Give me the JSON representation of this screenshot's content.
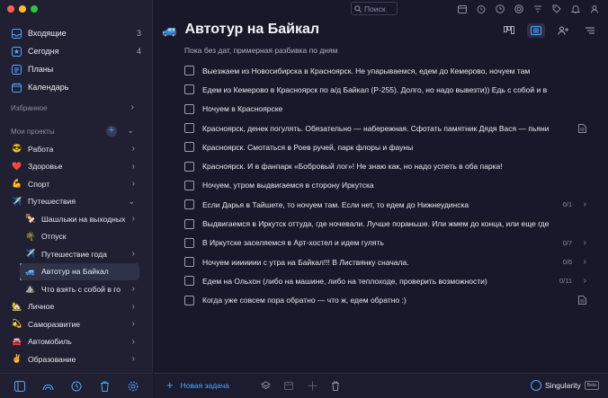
{
  "sidebar": {
    "nav": [
      {
        "label": "Входящие",
        "count": "3",
        "icon": "inbox-icon"
      },
      {
        "label": "Сегодня",
        "count": "4",
        "icon": "star-icon"
      },
      {
        "label": "Планы",
        "count": "",
        "icon": "plans-icon"
      },
      {
        "label": "Календарь",
        "count": "",
        "icon": "calendar-icon"
      }
    ],
    "favorites_label": "Избранное",
    "projects_label": "Мои проекты",
    "projects": [
      {
        "emoji": "😎",
        "label": "Работа",
        "level": 1
      },
      {
        "emoji": "❤️",
        "label": "Здоровье",
        "level": 1
      },
      {
        "emoji": "💪",
        "label": "Спорт",
        "level": 1
      },
      {
        "emoji": "✈️",
        "label": "Путешествия",
        "level": 1
      },
      {
        "emoji": "🍢",
        "label": "Шашлыки на выходных",
        "level": 2
      },
      {
        "emoji": "🌴",
        "label": "Отпуск",
        "level": 2
      },
      {
        "emoji": "✈️",
        "label": "Путешествие года",
        "level": 2
      },
      {
        "emoji": "🚙",
        "label": "Автотур на Байкал",
        "level": 2,
        "active": true
      },
      {
        "emoji": "⛰️",
        "label": "Что взять с собой в го",
        "level": 2
      },
      {
        "emoji": "🏡",
        "label": "Личное",
        "level": 1
      },
      {
        "emoji": "💫",
        "label": "Саморазвитие",
        "level": 1
      },
      {
        "emoji": "🚘",
        "label": "Автомобиль",
        "level": 1
      },
      {
        "emoji": "✌️",
        "label": "Образование",
        "level": 1
      }
    ]
  },
  "topbar": {
    "search_placeholder": "Поиск"
  },
  "project": {
    "emoji": "🚙",
    "title": "Автотур на Байкал",
    "subtitle": "Пока без дат, примерная разбивка по дням"
  },
  "tasks": [
    {
      "text": "Выезжаем из Новосибирска в Красноярск. Не упарываемся, едем до Кемерово, ночуем там",
      "meta": "",
      "chevron": false,
      "note": false
    },
    {
      "text": "Едем из Кемерово в Красноярск по а/д Байкал (Р-255). Долго, но надо вывезти)) Едь с собой и в",
      "meta": "",
      "chevron": false,
      "note": false
    },
    {
      "text": "Ночуем в Красноярске",
      "meta": "",
      "chevron": false,
      "note": false
    },
    {
      "text": "Красноярск, денек погулять. Обязательно — набережная. Сфотать памятник Дядя Вася — пьяни",
      "meta": "",
      "chevron": false,
      "note": true
    },
    {
      "text": "Красноярск. Смотаться в Роев ручей, парк флоры и фауны",
      "meta": "",
      "chevron": false,
      "note": false
    },
    {
      "text": "Красноярск. И в фанпарк «Бобровый лог»! Не знаю как, но надо успеть в оба парка!",
      "meta": "",
      "chevron": false,
      "note": false
    },
    {
      "text": "Ночуем, утром выдвигаемся в сторону Иркутска",
      "meta": "",
      "chevron": false,
      "note": false
    },
    {
      "text": "Если Дарья в Тайшете, то ночуем там. Если нет, то едем до Нижнеудинска",
      "meta": "0/1",
      "chevron": true,
      "note": false
    },
    {
      "text": "Выдвигаемся в Иркутск оттуда, где ночевали. Лучше пораньше. Или жмем до конца, или еще где",
      "meta": "",
      "chevron": false,
      "note": false
    },
    {
      "text": "В Иркутске заселяемся в Арт-хостел и идем гулять",
      "meta": "0/7",
      "chevron": true,
      "note": false
    },
    {
      "text": "Ночуем иииииии с утра на Байкал!!! В Листвянку сначала.",
      "meta": "0/6",
      "chevron": true,
      "note": false
    },
    {
      "text": "Едем на Ольхон (либо на машине, либо на теплоходе, проверить возможности)",
      "meta": "0/11",
      "chevron": true,
      "note": false
    },
    {
      "text": "Когда уже совсем пора обратно — что ж, едем обратно :)",
      "meta": "",
      "chevron": false,
      "note": true
    }
  ],
  "footer": {
    "new_task_label": "Новая задача",
    "brand": "Singularity",
    "badge": "Beta"
  },
  "colors": {
    "accent": "#4aa8ff",
    "sidebar_bg": "#212033",
    "main_bg": "#19182a"
  }
}
